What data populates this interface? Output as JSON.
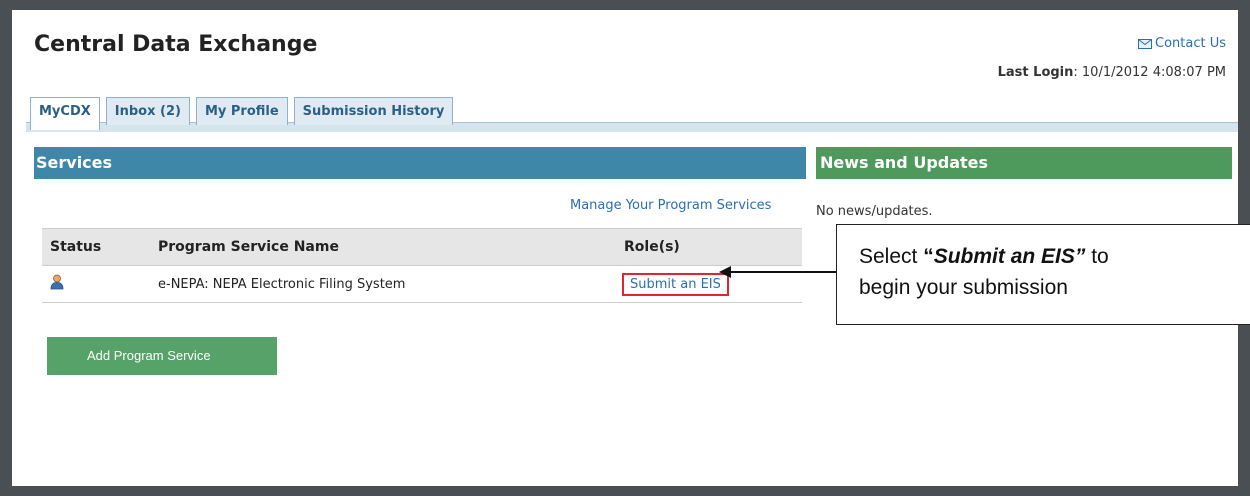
{
  "header": {
    "title": "Central Data Exchange",
    "contact": "Contact Us",
    "last_login_label": "Last Login",
    "last_login_value": ": 10/1/2012 4:08:07 PM"
  },
  "tabs": [
    {
      "label": "MyCDX",
      "active": true
    },
    {
      "label": "Inbox (2)",
      "active": false
    },
    {
      "label": "My Profile",
      "active": false
    },
    {
      "label": "Submission History",
      "active": false
    }
  ],
  "services": {
    "heading": "Services",
    "manage_link": "Manage Your Program Services",
    "columns": [
      "Status",
      "Program Service Name",
      "Role(s)"
    ],
    "rows": [
      {
        "status_icon": "user-icon",
        "name": "e-NEPA: NEPA Electronic Filing System",
        "role": "Submit an EIS"
      }
    ],
    "add_button": "Add Program Service"
  },
  "news": {
    "heading": "News and Updates",
    "empty_text": "No news/updates."
  },
  "callout": {
    "prefix": "Select ",
    "quote_open": "“",
    "emphasis": "Submit an EIS",
    "quote_close": "”",
    "suffix": " to",
    "line2": "begin your submission"
  },
  "colors": {
    "services_header": "#3f87a9",
    "news_header": "#4e9a5c",
    "add_button": "#56a269",
    "highlight_box": "#e1262d",
    "link": "#2a6fb0"
  }
}
